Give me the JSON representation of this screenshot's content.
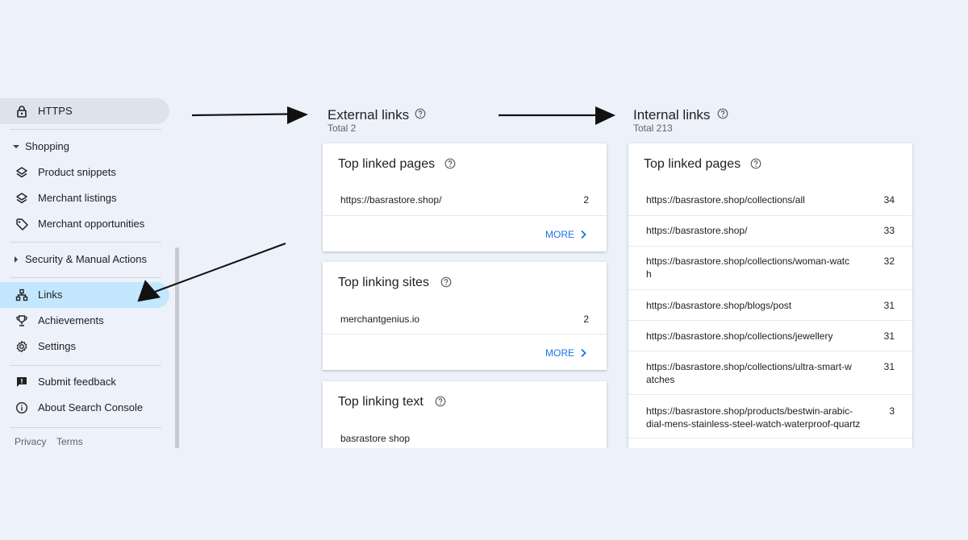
{
  "sidebar": {
    "https_label": "HTTPS",
    "shopping_label": "Shopping",
    "shopping_items": [
      {
        "label": "Product snippets",
        "icon": "layers-icon"
      },
      {
        "label": "Merchant listings",
        "icon": "layers-icon"
      },
      {
        "label": "Merchant opportunities",
        "icon": "tag-icon"
      }
    ],
    "security_label": "Security & Manual Actions",
    "links_label": "Links",
    "achievements_label": "Achievements",
    "settings_label": "Settings",
    "submit_feedback_label": "Submit feedback",
    "about_label": "About Search Console",
    "privacy_label": "Privacy",
    "terms_label": "Terms"
  },
  "external": {
    "title": "External links",
    "total": "Total 2",
    "top_linked_pages": {
      "title": "Top linked pages",
      "rows": [
        {
          "url": "https://basrastore.shop/",
          "count": "2"
        }
      ],
      "more_label": "MORE"
    },
    "top_linking_sites": {
      "title": "Top linking sites",
      "rows": [
        {
          "url": "merchantgenius.io",
          "count": "2"
        }
      ],
      "more_label": "MORE"
    },
    "top_linking_text": {
      "title": "Top linking text",
      "rows": [
        {
          "url": "basrastore shop",
          "count": ""
        }
      ]
    }
  },
  "internal": {
    "title": "Internal links",
    "total": "Total 213",
    "top_linked_pages": {
      "title": "Top linked pages",
      "rows": [
        {
          "url": "https://basrastore.shop/collections/all",
          "count": "34"
        },
        {
          "url": "https://basrastore.shop/",
          "count": "33"
        },
        {
          "url": "https://basrastore.shop/collections/woman-watc\nh",
          "count": "32"
        },
        {
          "url": "https://basrastore.shop/blogs/post",
          "count": "31"
        },
        {
          "url": "https://basrastore.shop/collections/jewellery",
          "count": "31"
        },
        {
          "url": "https://basrastore.shop/collections/ultra-smart-w\natches",
          "count": "31"
        },
        {
          "url": "https://basrastore.shop/products/bestwin-arabic-\ndial-mens-stainless-steel-watch-waterproof-quartz",
          "count": "3"
        }
      ]
    }
  },
  "colors": {
    "accent": "#1a73e8",
    "selected_blue": "#c2e7ff",
    "selected_grey": "#dde3ea",
    "background": "#edf1f9"
  }
}
